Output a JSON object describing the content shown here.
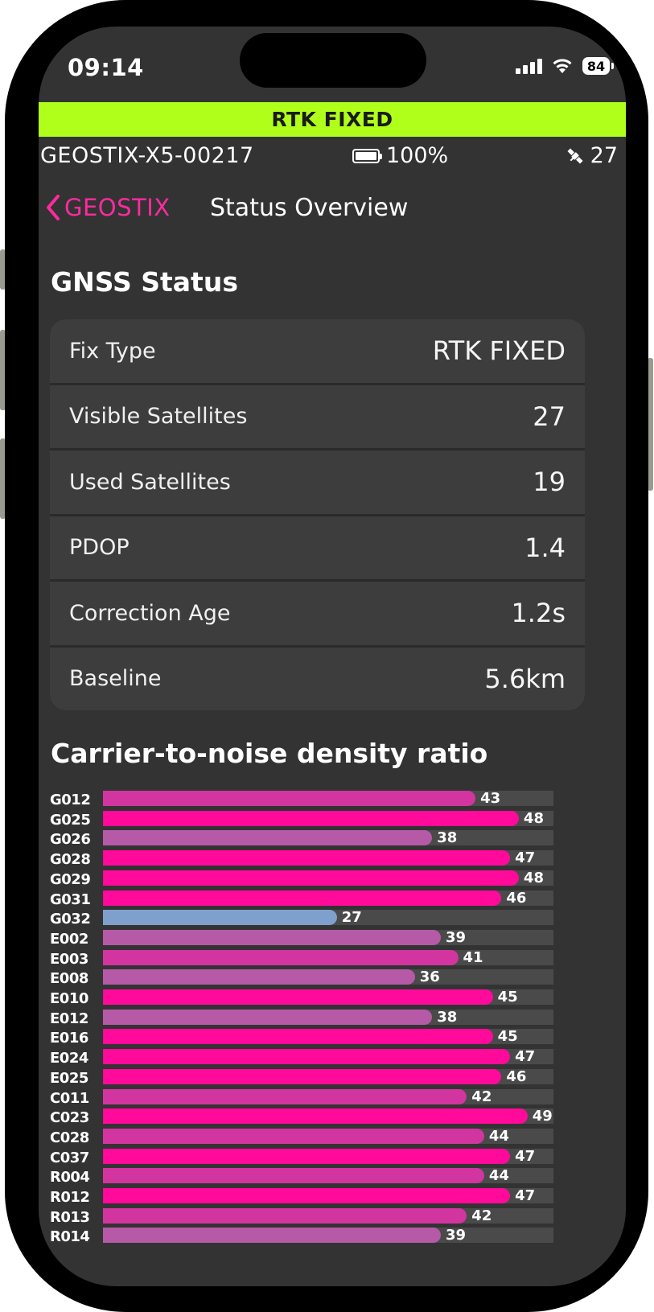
{
  "status_bar": {
    "time": "09:14",
    "battery": "84"
  },
  "banner": {
    "text": "RTK FIXED",
    "color": "#b0ff1a"
  },
  "device": {
    "name": "GEOSTIX-X5-00217",
    "battery": "100%",
    "satellites": "27"
  },
  "nav": {
    "back_label": "GEOSTIX",
    "title": "Status Overview"
  },
  "gnss": {
    "heading": "GNSS Status",
    "rows": [
      {
        "label": "Fix Type",
        "value": "RTK FIXED"
      },
      {
        "label": "Visible Satellites",
        "value": "27"
      },
      {
        "label": "Used Satellites",
        "value": "19"
      },
      {
        "label": "PDOP",
        "value": "1.4"
      },
      {
        "label": "Correction Age",
        "value": "1.2s"
      },
      {
        "label": "Baseline",
        "value": "5.6km"
      }
    ]
  },
  "cn0": {
    "heading": "Carrier-to-noise density ratio"
  },
  "colors": {
    "strong": "#ff0a9a",
    "medium": "#d335a0",
    "weak": "#b65aa8",
    "low": "#7fa0cc",
    "accent": "#ff2aa0"
  },
  "chart_data": {
    "type": "bar",
    "orientation": "horizontal",
    "title": "Carrier-to-noise density ratio",
    "xlim": [
      0,
      52
    ],
    "categories": [
      "G012",
      "G025",
      "G026",
      "G028",
      "G029",
      "G031",
      "G032",
      "E002",
      "E003",
      "E008",
      "E010",
      "E012",
      "E016",
      "E024",
      "E025",
      "C011",
      "C023",
      "C028",
      "C037",
      "R004",
      "R012",
      "R013",
      "R014"
    ],
    "values": [
      43,
      48,
      38,
      47,
      48,
      46,
      27,
      39,
      41,
      36,
      45,
      38,
      45,
      47,
      46,
      42,
      49,
      44,
      47,
      44,
      47,
      42,
      39
    ]
  }
}
